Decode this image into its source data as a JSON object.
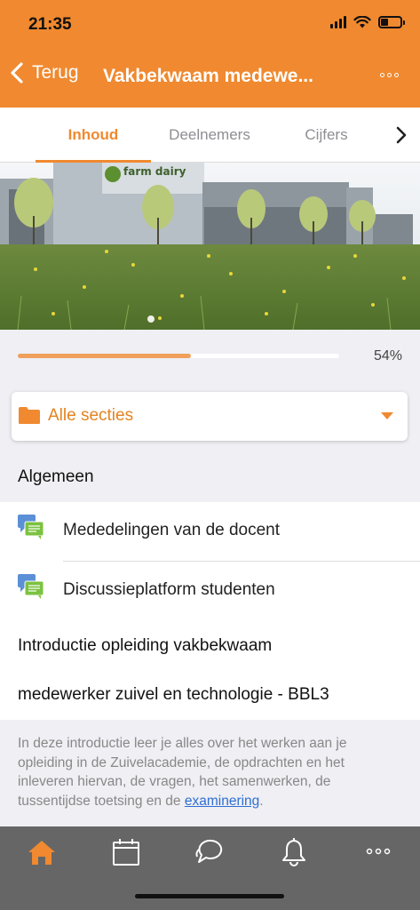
{
  "status_bar": {
    "time": "21:35"
  },
  "header": {
    "back_label": "Terug",
    "title": "Vakbekwaam medewe..."
  },
  "tabs": [
    {
      "label": "Inhoud",
      "active": true
    },
    {
      "label": "Deelnemers",
      "active": false
    },
    {
      "label": "Cijfers",
      "active": false
    }
  ],
  "hero": {
    "sign_text": "farm dairy"
  },
  "progress": {
    "value": 0.54,
    "label": "54%"
  },
  "section_select": {
    "selected": "Alle secties",
    "icon": "folder-icon"
  },
  "sections": {
    "general": {
      "title": "Algemeen",
      "items": [
        {
          "label": "Mededelingen van de docent",
          "icon": "forum-icon"
        },
        {
          "label": "Discussieplatform studenten",
          "icon": "forum-icon"
        }
      ]
    },
    "intro": {
      "title_line1": "Introductie opleiding vakbekwaam",
      "title_line2": "medewerker zuivel en technologie - BBL3",
      "summary_text": "In deze introductie leer je alles over het werken aan je opleiding in de Zuivelacademie, de opdrachten en het inleveren hiervan, de vragen, het samenwerken, de tussentijdse toetsing en de ",
      "summary_link": "examinering",
      "summary_end": "."
    }
  },
  "bottom_tabs": [
    "home-icon",
    "calendar-icon",
    "messages-icon",
    "notifications-icon",
    "more-icon"
  ],
  "colors": {
    "accent": "#f0892f",
    "link": "#2f6fd1",
    "tabbar": "#666666"
  }
}
